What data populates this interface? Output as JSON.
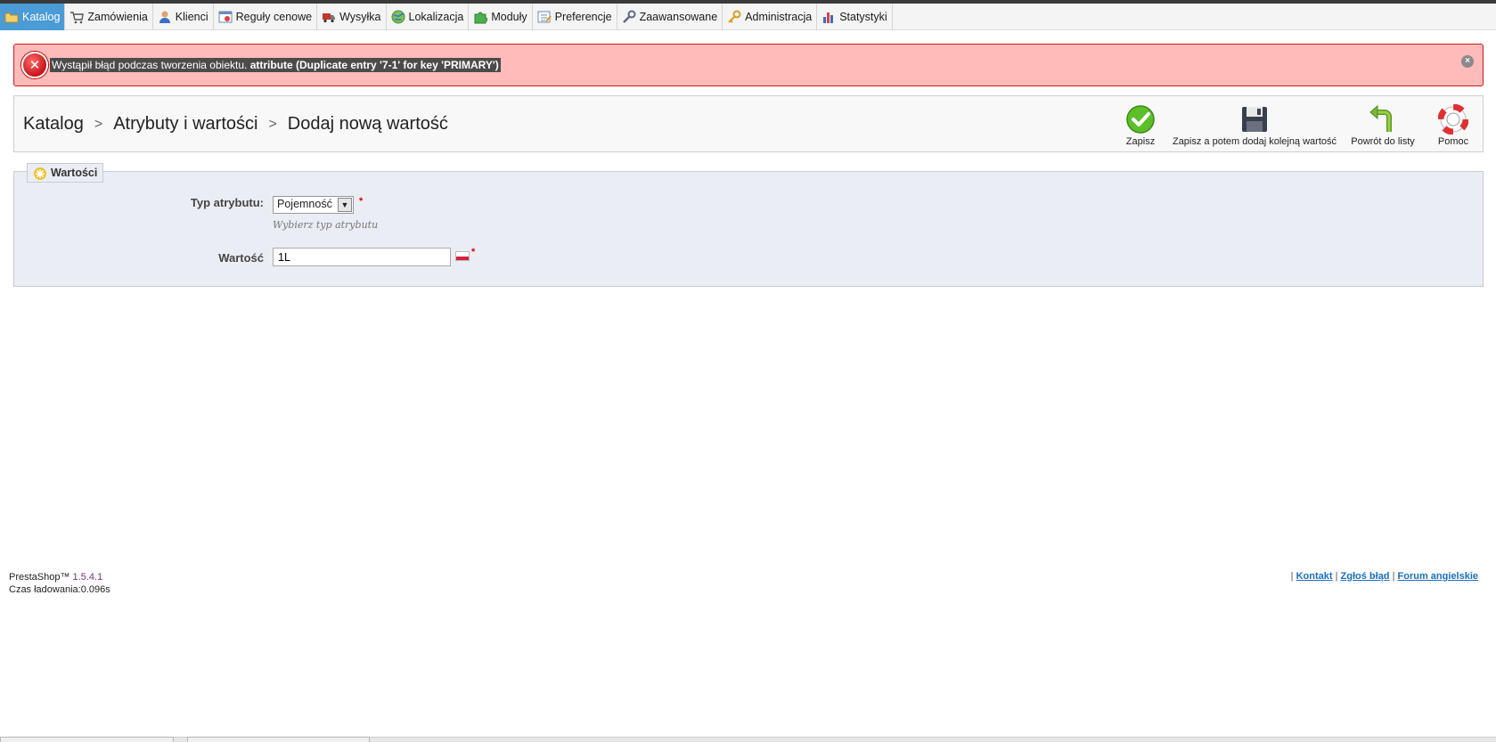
{
  "nav": {
    "items": [
      {
        "label": "Katalog",
        "icon": "folder-icon",
        "active": true
      },
      {
        "label": "Zamówienia",
        "icon": "cart-icon"
      },
      {
        "label": "Klienci",
        "icon": "user-icon"
      },
      {
        "label": "Reguły cenowe",
        "icon": "price-rules-icon"
      },
      {
        "label": "Wysyłka",
        "icon": "truck-icon"
      },
      {
        "label": "Lokalizacja",
        "icon": "globe-icon"
      },
      {
        "label": "Moduły",
        "icon": "puzzle-icon"
      },
      {
        "label": "Preferencje",
        "icon": "preferences-icon"
      },
      {
        "label": "Zaawansowane",
        "icon": "wrench-icon"
      },
      {
        "label": "Administracja",
        "icon": "key-icon"
      },
      {
        "label": "Statystyki",
        "icon": "bar-chart-icon"
      }
    ]
  },
  "error": {
    "message_plain": "Wystąpił błąd podczas tworzenia obiektu.",
    "message_bold": "attribute (Duplicate entry '7-1' for key 'PRIMARY')",
    "close_label": "×"
  },
  "breadcrumb": {
    "items": [
      "Katalog",
      "Atrybuty i wartości",
      "Dodaj nową wartość"
    ],
    "separator": ">"
  },
  "toolbar": {
    "save_label": "Zapisz",
    "save_add_label": "Zapisz a potem dodaj kolejną wartość",
    "back_label": "Powrót do listy",
    "help_label": "Pomoc"
  },
  "form": {
    "legend": "Wartości",
    "type_label": "Typ atrybutu:",
    "type_value": "Pojemność",
    "type_hint": "Wybierz typ atrybutu",
    "value_label": "Wartość",
    "value_input": "1L",
    "required_mark": "*"
  },
  "footer": {
    "brand": "PrestaShop™",
    "version": "1.5.4.1",
    "load_time": "Czas ładowania:0.096s",
    "links": [
      "Kontakt",
      "Zgłoś błąd",
      "Forum angielskie"
    ],
    "separator": "|"
  },
  "colors": {
    "nav_active": "#4a9bd6",
    "error_bg": "#ffbaba",
    "error_border": "#d21a1a",
    "fieldset_bg": "#ebedf4",
    "link": "#1b6fbf"
  }
}
